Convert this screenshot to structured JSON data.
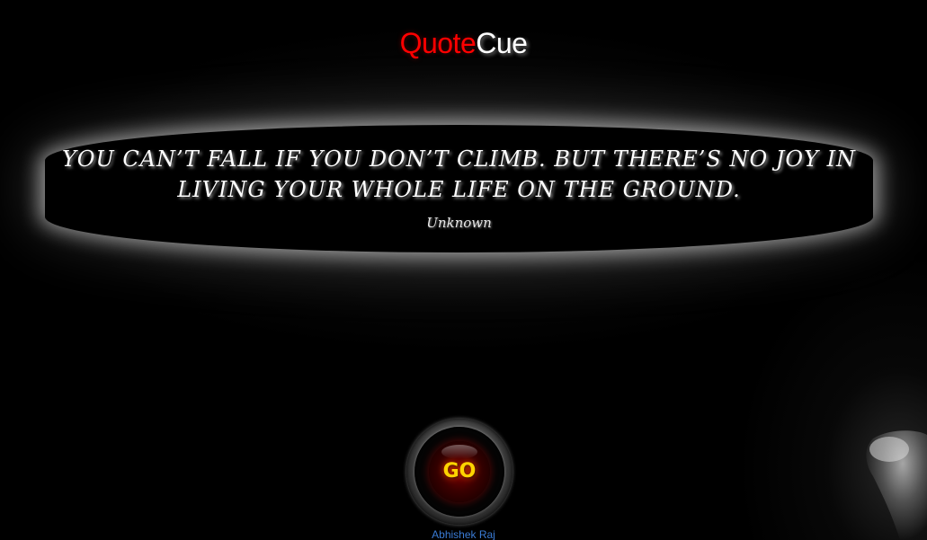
{
  "app": {
    "title_part1": "Quote",
    "title_part2": "Cue"
  },
  "quote": {
    "text": "You can’t fall if you don’t climb. But there’s no joy in living your whole life on the ground.",
    "author": "Unknown"
  },
  "button": {
    "label": "GO"
  },
  "footer": {
    "credit": "Abhishek Raj"
  },
  "colors": {
    "brand_red": "#ff0000",
    "text_white": "#ffffff",
    "button_yellow": "#ffd400",
    "link_blue": "#3a7bd5"
  }
}
